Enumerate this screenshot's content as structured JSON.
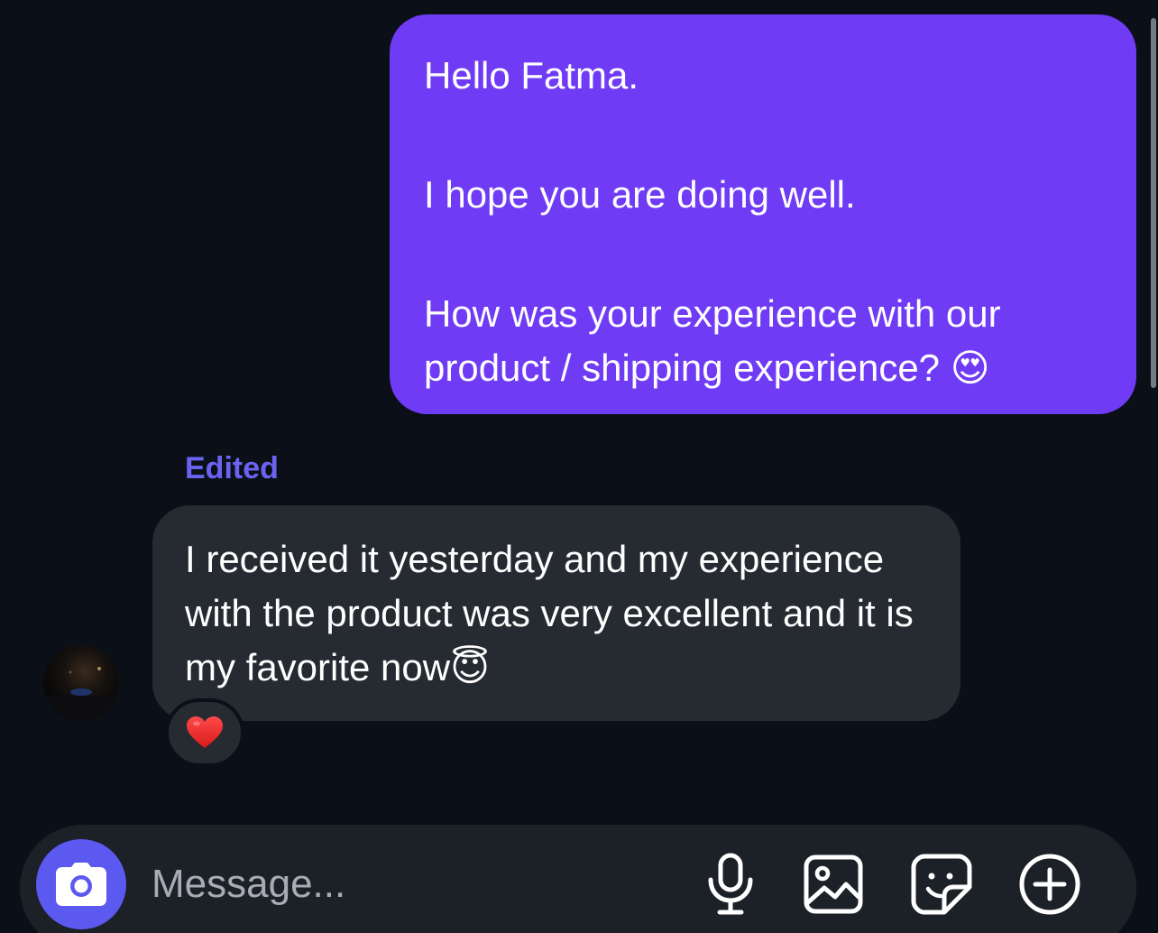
{
  "outgoing_message": {
    "line1": "Hello Fatma.",
    "line2": "I hope you are doing well.",
    "line3": "How was your experience with our product / shipping experience?",
    "emoji": "😍",
    "bubble_color": "#6f3bf5"
  },
  "incoming_message": {
    "edited_label": "Edited",
    "text": "I received it yesterday and my experience with the product was very excellent and it is my favorite now",
    "emoji": "😇",
    "reaction": "❤️",
    "bubble_color": "#262a31"
  },
  "composer": {
    "placeholder": "Message...",
    "camera_icon": "camera-icon",
    "tools": [
      "microphone-icon",
      "image-icon",
      "sticker-icon",
      "plus-circle-icon"
    ],
    "accent": "#5b59f0"
  },
  "theme": {
    "background": "#0b0f17",
    "edited_color": "#6a63f2"
  }
}
